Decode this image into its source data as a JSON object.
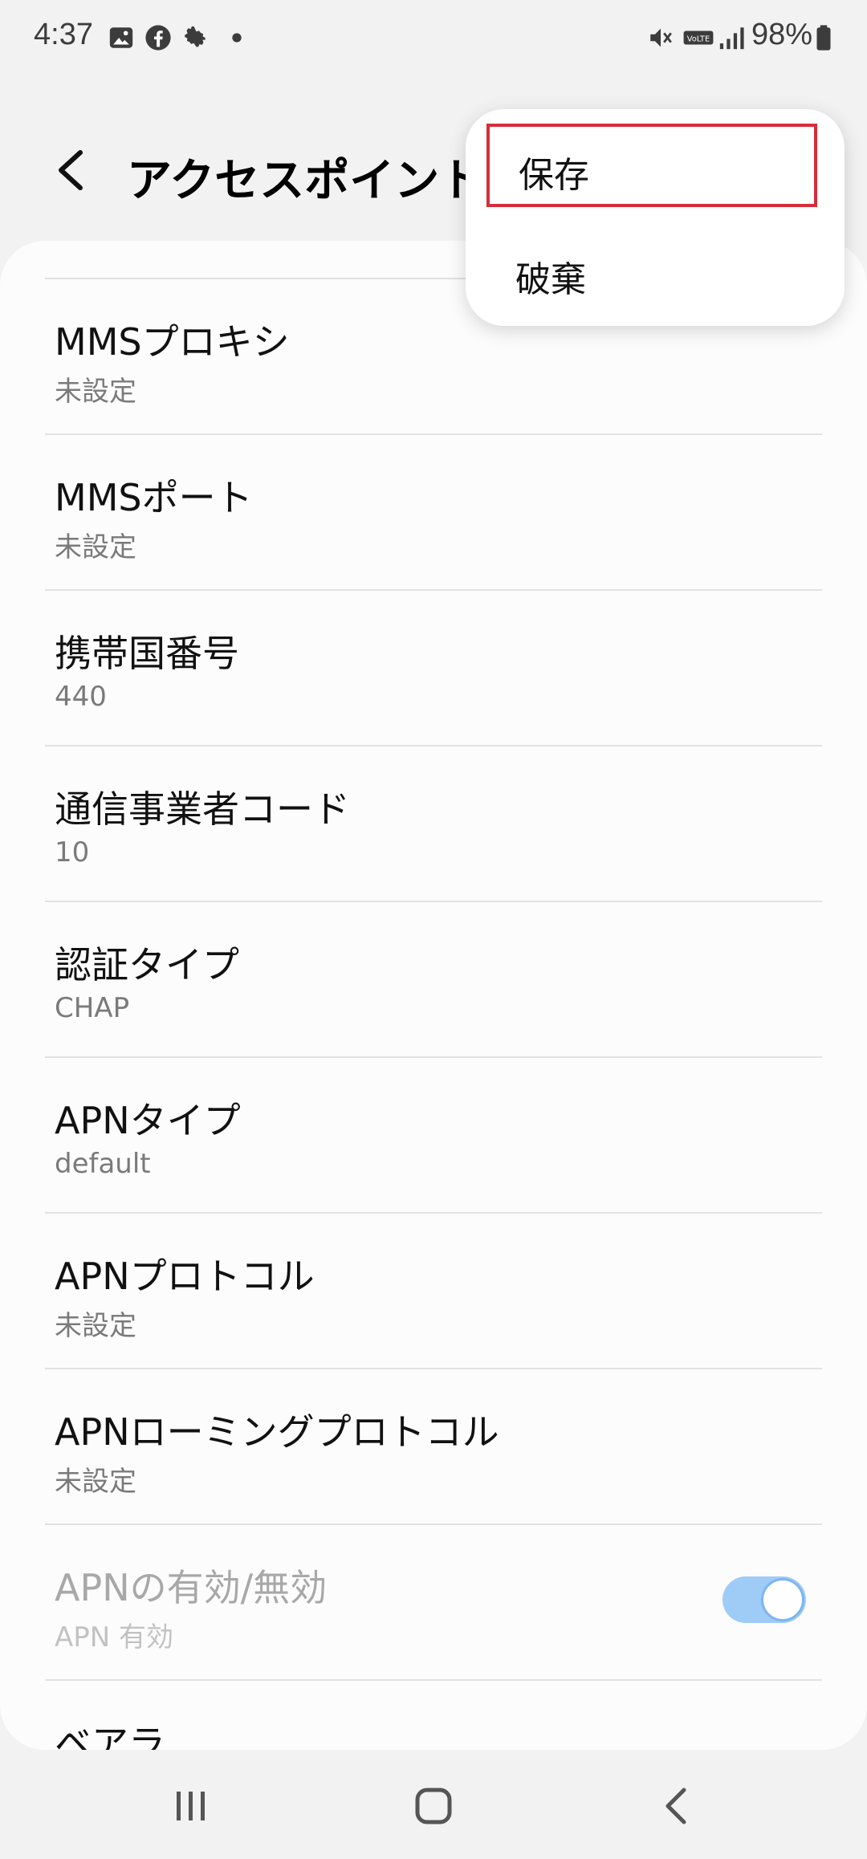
{
  "status_bar": {
    "time": "4:37",
    "battery": "98%",
    "icons": [
      "gallery-icon",
      "facebook-icon",
      "settings-gear-icon",
      "dot-icon",
      "mute-icon",
      "volte-icon",
      "signal-icon",
      "battery-icon"
    ]
  },
  "header": {
    "title": "アクセスポイント"
  },
  "menu": {
    "items": [
      {
        "label": "保存"
      },
      {
        "label": "破棄"
      }
    ]
  },
  "list": {
    "items": [
      {
        "title": "MMSプロキシ",
        "value": "未設定"
      },
      {
        "title": "MMSポート",
        "value": "未設定"
      },
      {
        "title": "携帯国番号",
        "value": "440"
      },
      {
        "title": "通信事業者コード",
        "value": "10"
      },
      {
        "title": "認証タイプ",
        "value": "CHAP"
      },
      {
        "title": "APNタイプ",
        "value": "default"
      },
      {
        "title": "APNプロトコル",
        "value": "未設定"
      },
      {
        "title": "APNローミングプロトコル",
        "value": "未設定"
      },
      {
        "title": "APNの有効/無効",
        "value": "APN 有効",
        "toggle_on": true
      },
      {
        "title": "ベアラ",
        "value": ""
      }
    ]
  },
  "colors": {
    "accent": "#9fcbf7",
    "highlight": "#d62d3a"
  }
}
